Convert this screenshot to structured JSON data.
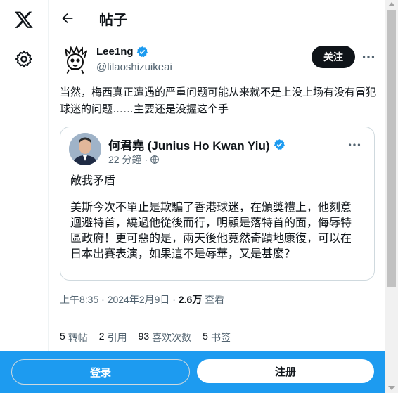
{
  "header": {
    "title": "帖子"
  },
  "post": {
    "author_name": "Lee1ng",
    "author_handle": "@lilaoshizuikeai",
    "follow_label": "关注",
    "text": "当然，梅西真正遭遇的严重问题可能从来就不是上没上场有没有冒犯球迷的问题……主要还是没握这个手",
    "time": "上午8:35 · 2024年2月9日 · ",
    "views_count": "2.6万",
    "views_label": " 查看"
  },
  "quote": {
    "author_name": "何君堯 (Junius Ho Kwan Yiu)",
    "time": "22 分鐘 ·",
    "line1": "敵我矛盾",
    "line2": "美斯今次不單止是欺騙了香港球迷，在頒獎禮上，他刻意迴避特首，繞過他從後而行，明顯是落特首的面，侮辱特區政府！更可惡的是，兩天後他竟然奇蹟地康復，可以在日本出賽表演，如果這不是辱華，又是甚麼？"
  },
  "stats": {
    "reposts_count": "5",
    "reposts_label": "转帖",
    "quotes_count": "2",
    "quotes_label": "引用",
    "likes_count": "93",
    "likes_label": "喜欢次数",
    "bookmarks_count": "5",
    "bookmarks_label": "书签"
  },
  "bottom_bar": {
    "login_label": "登录",
    "signup_label": "注册"
  },
  "colors": {
    "accent": "#1d9bf0",
    "text": "#0f1419",
    "muted": "#536471",
    "border": "#cfd9de"
  }
}
